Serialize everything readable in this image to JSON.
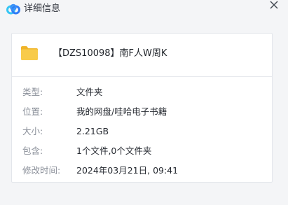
{
  "window": {
    "title": "详细信息",
    "app_icon": "cloud-icon",
    "close_icon": "close-icon"
  },
  "file": {
    "icon": "folder-icon",
    "name": "【DZS10098】南F人W周K"
  },
  "details": [
    {
      "label": "类型:",
      "value": "文件夹"
    },
    {
      "label": "位置:",
      "value": "我的网盘/哇哈电子书籍"
    },
    {
      "label": "大小:",
      "value": "2.21GB"
    },
    {
      "label": "包含:",
      "value": "1个文件,0个文件夹"
    },
    {
      "label": "修改时间:",
      "value": "2024年03月21日, 09:41"
    }
  ],
  "colors": {
    "window_bg": "#f4f5f7",
    "card_bg": "#ffffff",
    "folder": "#f6c343",
    "cloud_blue": "#2f7cf6",
    "cloud_cyan": "#36c6f4"
  }
}
